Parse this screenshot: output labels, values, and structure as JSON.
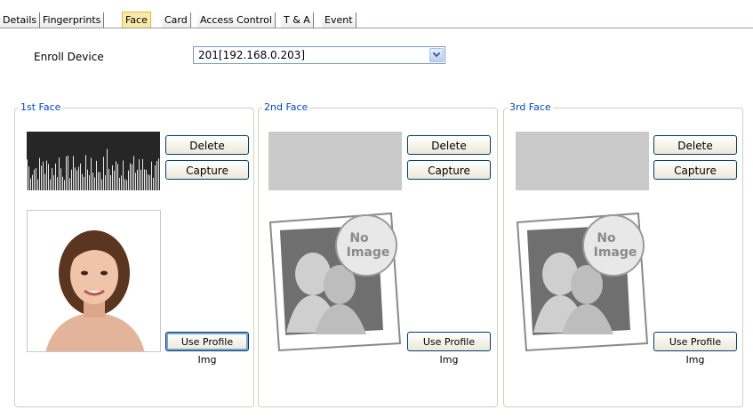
{
  "tabs": [
    {
      "label": "Details"
    },
    {
      "label": "Fingerprints"
    },
    {
      "label": "Face",
      "active": true
    },
    {
      "label": "Card"
    },
    {
      "label": "Access Control"
    },
    {
      "label": "T & A"
    },
    {
      "label": "Event"
    }
  ],
  "enroll": {
    "label": "Enroll Device",
    "selected": "201[192.168.0.203]"
  },
  "faces": [
    {
      "legend": "1st Face",
      "delete_label": "Delete",
      "capture_label": "Capture",
      "use_profile_label": "Use Profile Img",
      "has_template": true,
      "has_photo": true
    },
    {
      "legend": "2nd Face",
      "delete_label": "Delete",
      "capture_label": "Capture",
      "use_profile_label": "Use Profile Img",
      "has_template": false,
      "has_photo": false
    },
    {
      "legend": "3rd Face",
      "delete_label": "Delete",
      "capture_label": "Capture",
      "use_profile_label": "Use Profile Img",
      "has_template": false,
      "has_photo": false
    }
  ],
  "no_image_text": [
    "No",
    "Image"
  ],
  "colors": {
    "legend": "#0046d5",
    "active_tab": "#fbe9a9",
    "button_border": "#003c74"
  }
}
